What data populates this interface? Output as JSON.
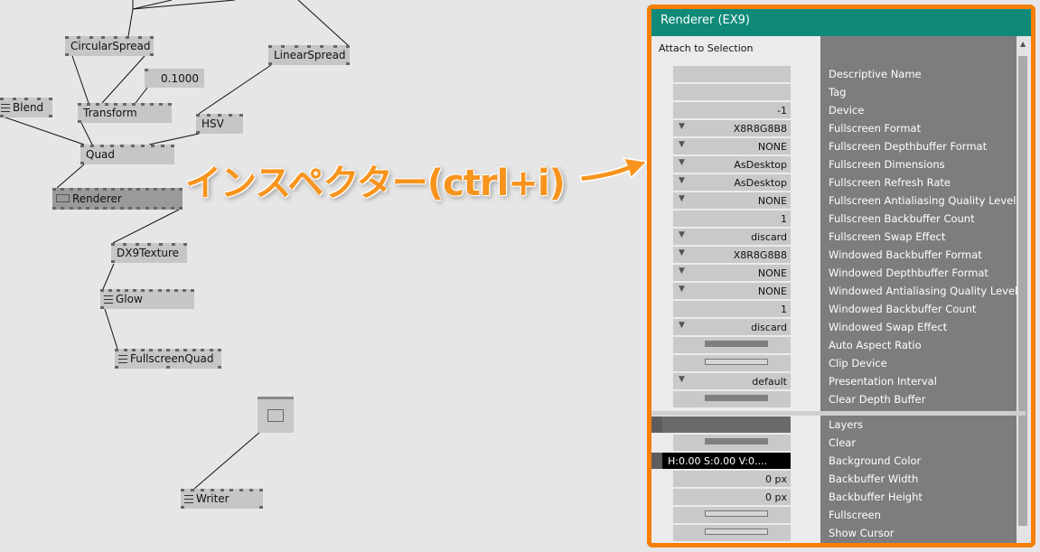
{
  "nodes": {
    "circular_spread": "CircularSpread",
    "linear_spread": "LinearSpread",
    "iobox_value": "0.1000",
    "blend": "Blend",
    "transform": "Transform",
    "hsv": "HSV",
    "quad": "Quad",
    "renderer": "Renderer",
    "dx9texture": "DX9Texture",
    "glow": "Glow",
    "fullscreen_quad": "FullscreenQuad",
    "writer": "Writer"
  },
  "callout": "インスペクター(ctrl+i)",
  "inspector": {
    "title": "Renderer (EX9)",
    "attach_label": "Attach to Selection",
    "rows": [
      {
        "name": "Descriptive Name",
        "value": "",
        "kind": "text"
      },
      {
        "name": "Tag",
        "value": "",
        "kind": "text"
      },
      {
        "name": "Device",
        "value": "-1",
        "kind": "text"
      },
      {
        "name": "Fullscreen Format",
        "value": "X8R8G8B8",
        "kind": "enum"
      },
      {
        "name": "Fullscreen Depthbuffer Format",
        "value": "NONE",
        "kind": "enum"
      },
      {
        "name": "Fullscreen Dimensions",
        "value": "AsDesktop",
        "kind": "enum"
      },
      {
        "name": "Fullscreen Refresh Rate",
        "value": "AsDesktop",
        "kind": "enum"
      },
      {
        "name": "Fullscreen Antialiasing Quality Level",
        "value": "NONE",
        "kind": "enum"
      },
      {
        "name": "Fullscreen Backbuffer Count",
        "value": "1",
        "kind": "text"
      },
      {
        "name": "Fullscreen Swap Effect",
        "value": "discard",
        "kind": "enum"
      },
      {
        "name": "Windowed Backbuffer Format",
        "value": "X8R8G8B8",
        "kind": "enum"
      },
      {
        "name": "Windowed Depthbuffer Format",
        "value": "NONE",
        "kind": "enum"
      },
      {
        "name": "Windowed Antialiasing Quality Level",
        "value": "NONE",
        "kind": "enum"
      },
      {
        "name": "Windowed Backbuffer Count",
        "value": "1",
        "kind": "text"
      },
      {
        "name": "Windowed Swap Effect",
        "value": "discard",
        "kind": "enum"
      },
      {
        "name": "Auto Aspect Ratio",
        "value": "",
        "kind": "toggle-on"
      },
      {
        "name": "Clip Device",
        "value": "",
        "kind": "toggle-off"
      },
      {
        "name": "Presentation Interval",
        "value": "default",
        "kind": "enum"
      },
      {
        "name": "Clear Depth Buffer",
        "value": "",
        "kind": "toggle-on"
      }
    ],
    "input_rows": [
      {
        "name": "Layers",
        "value": "",
        "kind": "layers"
      },
      {
        "name": "Clear",
        "value": "",
        "kind": "toggle-on"
      },
      {
        "name": "Background Color",
        "value": "H:0.00  S:0.00  V:0....",
        "kind": "color"
      },
      {
        "name": "Backbuffer Width",
        "value": "0 px",
        "kind": "text"
      },
      {
        "name": "Backbuffer Height",
        "value": "0 px",
        "kind": "text"
      },
      {
        "name": "Fullscreen",
        "value": "",
        "kind": "toggle-off"
      },
      {
        "name": "Show Cursor",
        "value": "",
        "kind": "toggle-off"
      }
    ]
  },
  "colors": {
    "accent": "#f57e0a",
    "title_bar": "#0f8a79",
    "callout_text": "#f7941d"
  },
  "icons": [
    "node-menu-icon",
    "dropdown-triangle-icon",
    "orange-arrow-icon",
    "scroll-up-icon"
  ]
}
